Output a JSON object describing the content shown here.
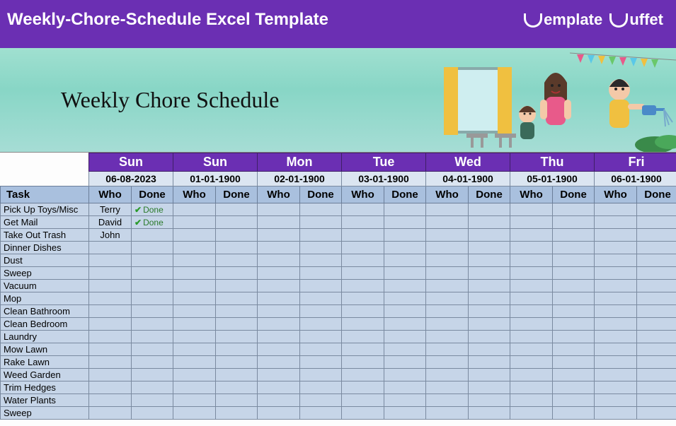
{
  "top_bar": {
    "title": "Weekly-Chore-Schedule Excel Template",
    "brand_word1": "emplate",
    "brand_word2": "uffet"
  },
  "hero": {
    "title": "Weekly Chore Schedule"
  },
  "columns": {
    "task_label": "Task",
    "who_label": "Who",
    "done_label": "Done"
  },
  "days": [
    {
      "name": "Sun",
      "date": "06-08-2023"
    },
    {
      "name": "Sun",
      "date": "01-01-1900"
    },
    {
      "name": "Mon",
      "date": "02-01-1900"
    },
    {
      "name": "Tue",
      "date": "03-01-1900"
    },
    {
      "name": "Wed",
      "date": "04-01-1900"
    },
    {
      "name": "Thu",
      "date": "05-01-1900"
    },
    {
      "name": "Fri",
      "date": "06-01-1900"
    }
  ],
  "tasks": [
    {
      "name": "Pick Up Toys/Misc",
      "cells": [
        {
          "who": "Terry",
          "done": "Done"
        },
        {},
        {},
        {},
        {},
        {},
        {}
      ]
    },
    {
      "name": "Get Mail",
      "cells": [
        {
          "who": "David",
          "done": "Done"
        },
        {},
        {},
        {},
        {},
        {},
        {}
      ]
    },
    {
      "name": "Take Out Trash",
      "cells": [
        {
          "who": "John"
        },
        {},
        {},
        {},
        {},
        {},
        {}
      ]
    },
    {
      "name": "Dinner Dishes",
      "cells": [
        {},
        {},
        {},
        {},
        {},
        {},
        {}
      ]
    },
    {
      "name": "Dust",
      "cells": [
        {},
        {},
        {},
        {},
        {},
        {},
        {}
      ]
    },
    {
      "name": "Sweep",
      "cells": [
        {},
        {},
        {},
        {},
        {},
        {},
        {}
      ]
    },
    {
      "name": "Vacuum",
      "cells": [
        {},
        {},
        {},
        {},
        {},
        {},
        {}
      ]
    },
    {
      "name": "Mop",
      "cells": [
        {},
        {},
        {},
        {},
        {},
        {},
        {}
      ]
    },
    {
      "name": "Clean Bathroom",
      "cells": [
        {},
        {},
        {},
        {},
        {},
        {},
        {}
      ]
    },
    {
      "name": "Clean Bedroom",
      "cells": [
        {},
        {},
        {},
        {},
        {},
        {},
        {}
      ]
    },
    {
      "name": "Laundry",
      "cells": [
        {},
        {},
        {},
        {},
        {},
        {},
        {}
      ]
    },
    {
      "name": "Mow Lawn",
      "cells": [
        {},
        {},
        {},
        {},
        {},
        {},
        {}
      ]
    },
    {
      "name": "Rake Lawn",
      "cells": [
        {},
        {},
        {},
        {},
        {},
        {},
        {}
      ]
    },
    {
      "name": "Weed Garden",
      "cells": [
        {},
        {},
        {},
        {},
        {},
        {},
        {}
      ]
    },
    {
      "name": "Trim Hedges",
      "cells": [
        {},
        {},
        {},
        {},
        {},
        {},
        {}
      ]
    },
    {
      "name": "Water Plants",
      "cells": [
        {},
        {},
        {},
        {},
        {},
        {},
        {}
      ]
    },
    {
      "name": "Sweep",
      "cells": [
        {},
        {},
        {},
        {},
        {},
        {},
        {}
      ]
    }
  ]
}
